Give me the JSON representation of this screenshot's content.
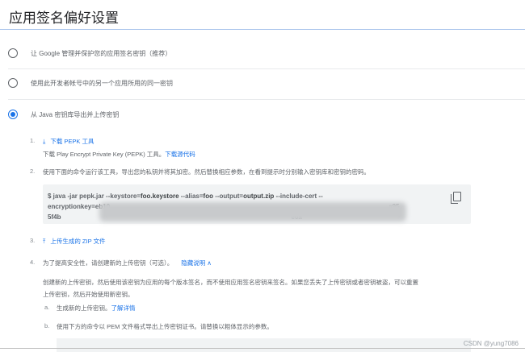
{
  "title": "应用签名偏好设置",
  "options": [
    {
      "label": "让 Google 管理并保护您的应用签名密钥（推荐）",
      "selected": false
    },
    {
      "label": "使用此开发者帐号中的另一个应用所用的同一密钥",
      "selected": false
    },
    {
      "label": "从 Java 密钥库导出并上传密钥",
      "selected": true
    }
  ],
  "steps": {
    "s1": {
      "num": "1.",
      "link": "下载 PEPK 工具",
      "desc": "下载 Play Encrypt Private Key (PEPK) 工具。",
      "desc_link": "下载源代码"
    },
    "s2": {
      "num": "2.",
      "text": "使用下面的命令运行该工具，导出您的私钥并将其加密。然后替换相应参数，在看到提示时分别输入密钥库和密钥的密码。"
    },
    "code": {
      "p1": "$ java -jar pepk.jar --keystore=",
      "b1": "foo.keystore",
      "p2": " --alias=",
      "b2": "foo",
      "p3": " --output=",
      "b3": "output.zip",
      "p4": " --include-cert --",
      "line2a": "encryptionkey=eb10",
      "line2b": "a95",
      "line3a": "5f4b",
      "line3b": "e6a"
    },
    "s3": {
      "num": "3.",
      "link": "上传生成的 ZIP 文件"
    },
    "s4": {
      "num": "4.",
      "text": "为了提高安全性，请创建新的上传密钥（可选）。",
      "link": "隐藏说明 ∧",
      "para1": "创建新的上传密钥，然后使用该密钥为应用的每个版本签名，而不使用应用签名密钥来签名。如果您丢失了上传密钥或者密钥被盗，可以重置",
      "para2": "上传密钥，然后开始使用新密钥。",
      "a": {
        "num": "a.",
        "text": "生成新的上传密钥。",
        "link": "了解详情"
      },
      "b": {
        "num": "b.",
        "text": "使用下方的命令以 PEM 文件格式导出上传密钥证书。请替换以粗体显示的参数。"
      }
    }
  },
  "watermark": "CSDN @yung7086"
}
